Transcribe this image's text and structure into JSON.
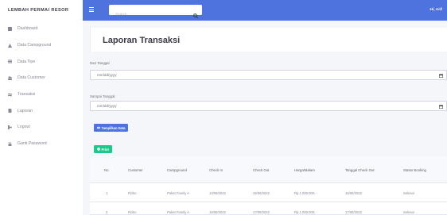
{
  "brand": "LEMBAH PERMAI RESOR",
  "sidebar": {
    "items": [
      {
        "label": "Dashboard",
        "icon": "dashboard-icon"
      },
      {
        "label": "Data Campground",
        "icon": "campground-icon"
      },
      {
        "label": "Data Tipe",
        "icon": "list-icon"
      },
      {
        "label": "Data Customer",
        "icon": "users-icon"
      },
      {
        "label": "Transaksi",
        "icon": "exchange-icon"
      },
      {
        "label": "Laporan",
        "icon": "report-icon"
      },
      {
        "label": "Logout",
        "icon": "logout-icon"
      },
      {
        "label": "Ganti Password",
        "icon": "lock-icon"
      }
    ]
  },
  "topbar": {
    "search_placeholder": "Search",
    "user_greeting": "Hi, Arif"
  },
  "page": {
    "title": "Laporan Transaksi",
    "from_label": "Dari Tanggal",
    "from_value": "mm/dd/yyyy",
    "to_label": "Sampai Tanggal",
    "to_value": "mm/dd/yyyy",
    "show_button": "Tampilkan Data",
    "print_button": "Print"
  },
  "table": {
    "headers": [
      "No",
      "Customer",
      "Campground",
      "Check In",
      "Check Out",
      "Harga/Malam",
      "Tanggal Check Out",
      "Status Booking"
    ],
    "rows": [
      [
        "1",
        "Rizko",
        "Paket Family A",
        "13/06/2022",
        "15/06/2022",
        "Rp.1.000.000,-",
        "15/06/2022",
        "Selesai"
      ],
      [
        "2",
        "Rizko",
        "Paket Family A",
        "15/06/2022",
        "17/06/2022",
        "Rp.1.000.000,-",
        "17/06/2022",
        "Selesai"
      ]
    ]
  },
  "colors": {
    "primary": "#4e73df",
    "success": "#1cc88a",
    "sidebar_text": "#858796",
    "heading_text": "#3a3b45"
  }
}
